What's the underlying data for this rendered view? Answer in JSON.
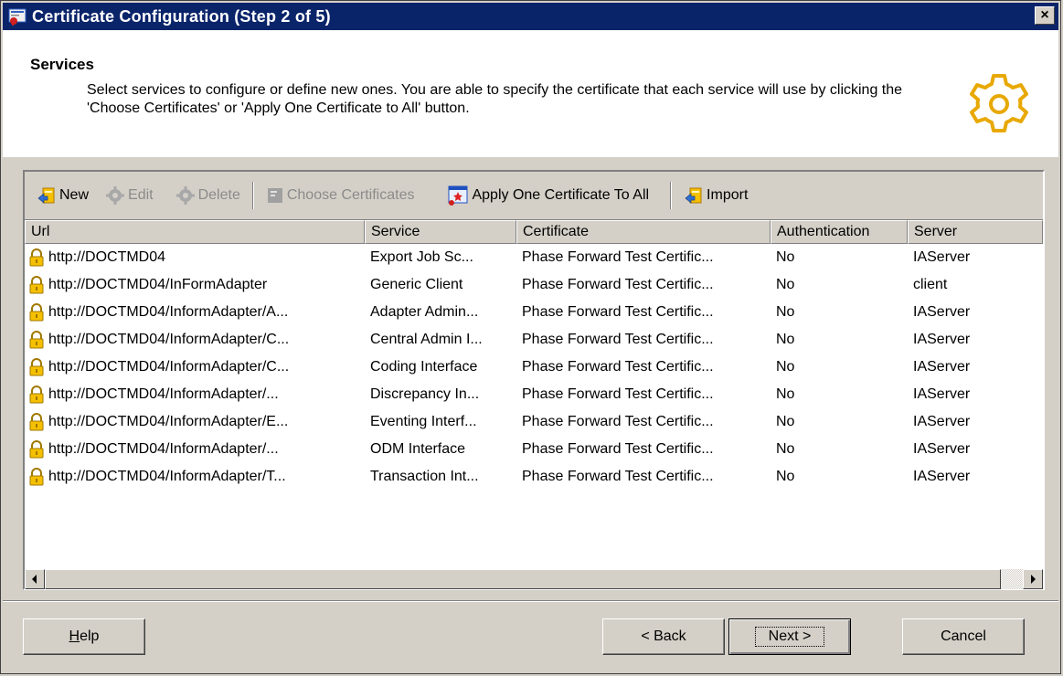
{
  "window": {
    "title": "Certificate Configuration (Step 2 of 5)",
    "close_symbol": "×"
  },
  "header": {
    "title": "Services",
    "description": "Select services to configure or define new ones.  You are able to specify the certificate that each service will use by clicking the 'Choose Certificates' or 'Apply One Certificate to All' button.",
    "icon": "gear-icon"
  },
  "toolbar": {
    "new": "New",
    "edit": "Edit",
    "delete": "Delete",
    "choose_certificates": "Choose Certificates",
    "apply_one": "Apply One Certificate To All",
    "import": "Import"
  },
  "table": {
    "columns": [
      "Url",
      "Service",
      "Certificate",
      "Authentication",
      "Server"
    ],
    "rows": [
      {
        "url": "http://DOCTMD04",
        "service": "Export Job Sc...",
        "certificate": "Phase Forward Test Certific...",
        "auth": "No",
        "server": "IAServer"
      },
      {
        "url": "http://DOCTMD04/InFormAdapter",
        "service": "Generic Client",
        "certificate": "Phase Forward Test Certific...",
        "auth": "No",
        "server": "client"
      },
      {
        "url": "http://DOCTMD04/InformAdapter/A...",
        "service": "Adapter Admin...",
        "certificate": "Phase Forward Test Certific...",
        "auth": "No",
        "server": "IAServer"
      },
      {
        "url": "http://DOCTMD04/InformAdapter/C...",
        "service": "Central Admin I...",
        "certificate": "Phase Forward Test Certific...",
        "auth": "No",
        "server": "IAServer"
      },
      {
        "url": "http://DOCTMD04/InformAdapter/C...",
        "service": "Coding Interface",
        "certificate": "Phase Forward Test Certific...",
        "auth": "No",
        "server": "IAServer"
      },
      {
        "url": "http://DOCTMD04/InformAdapter/...",
        "service": "Discrepancy In...",
        "certificate": "Phase Forward Test Certific...",
        "auth": "No",
        "server": "IAServer"
      },
      {
        "url": "http://DOCTMD04/InformAdapter/E...",
        "service": "Eventing Interf...",
        "certificate": "Phase Forward Test Certific...",
        "auth": "No",
        "server": "IAServer"
      },
      {
        "url": "http://DOCTMD04/InformAdapter/...",
        "service": "ODM Interface",
        "certificate": "Phase Forward Test Certific...",
        "auth": "No",
        "server": "IAServer"
      },
      {
        "url": "http://DOCTMD04/InformAdapter/T...",
        "service": "Transaction Int...",
        "certificate": "Phase Forward Test Certific...",
        "auth": "No",
        "server": "IAServer"
      }
    ]
  },
  "buttons": {
    "help_first": "H",
    "help_rest": "elp",
    "back": "< Back",
    "next": "Next >",
    "cancel": "Cancel"
  }
}
